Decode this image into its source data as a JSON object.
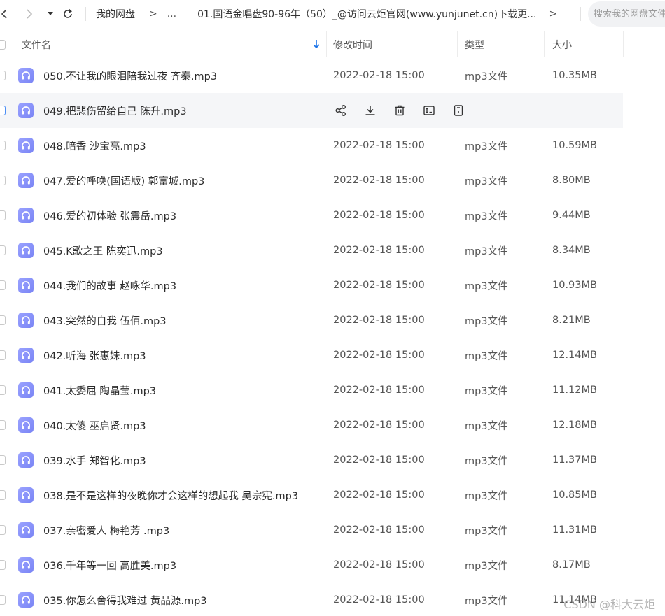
{
  "nav": {
    "back_icon": "chevron-left-icon",
    "forward_icon": "chevron-right-icon",
    "history_icon": "caret-down-icon",
    "refresh_icon": "refresh-icon"
  },
  "breadcrumb": {
    "root": "我的网盘",
    "sep": ">",
    "ellipsis": "...",
    "current": "01.国语金唱盘90-96年（50）_@访问云炬官网(www.yunjunet.cn)下载更...",
    "end_sep": ">"
  },
  "search": {
    "placeholder": "搜索我的网盘文件"
  },
  "table": {
    "headers": {
      "name": "文件名",
      "time": "修改时间",
      "type": "类型",
      "size": "大小"
    },
    "sort_icon": "arrow-down-icon",
    "rows": [
      {
        "name": "050.不让我的眼泪陪我过夜  齐秦.mp3",
        "time": "2022-02-18 15:00",
        "type": "mp3文件",
        "size": "10.35MB"
      },
      {
        "name": "049.把悲伤留给自己 陈升.mp3",
        "time": "",
        "type": "",
        "size": "",
        "hover": true
      },
      {
        "name": "048.暗香  沙宝亮.mp3",
        "time": "2022-02-18 15:00",
        "type": "mp3文件",
        "size": "10.59MB"
      },
      {
        "name": "047.爱的呼唤(国语版) 郭富城.mp3",
        "time": "2022-02-18 15:00",
        "type": "mp3文件",
        "size": "8.80MB"
      },
      {
        "name": "046.爱的初体验  张震岳.mp3",
        "time": "2022-02-18 15:00",
        "type": "mp3文件",
        "size": "9.44MB"
      },
      {
        "name": "045.K歌之王  陈奕迅.mp3",
        "time": "2022-02-18 15:00",
        "type": "mp3文件",
        "size": "8.34MB"
      },
      {
        "name": "044.我们的故事  赵咏华.mp3",
        "time": "2022-02-18 15:00",
        "type": "mp3文件",
        "size": "10.93MB"
      },
      {
        "name": "043.突然的自我   伍佰.mp3",
        "time": "2022-02-18 15:00",
        "type": "mp3文件",
        "size": "8.21MB"
      },
      {
        "name": "042.听海  张惠妹.mp3",
        "time": "2022-02-18 15:00",
        "type": "mp3文件",
        "size": "12.14MB"
      },
      {
        "name": "041.太委屈  陶晶莹.mp3",
        "time": "2022-02-18 15:00",
        "type": "mp3文件",
        "size": "11.12MB"
      },
      {
        "name": "040.太傻  巫启贤.mp3",
        "time": "2022-02-18 15:00",
        "type": "mp3文件",
        "size": "12.18MB"
      },
      {
        "name": "039.水手  郑智化.mp3",
        "time": "2022-02-18 15:00",
        "type": "mp3文件",
        "size": "11.37MB"
      },
      {
        "name": "038.是不是这样的夜晚你才会这样的想起我  吴宗宪.mp3",
        "time": "2022-02-18 15:00",
        "type": "mp3文件",
        "size": "10.85MB"
      },
      {
        "name": "037.亲密爱人 梅艳芳  .mp3",
        "time": "2022-02-18 15:00",
        "type": "mp3文件",
        "size": "11.31MB"
      },
      {
        "name": "036.千年等一回   高胜美.mp3",
        "time": "2022-02-18 15:00",
        "type": "mp3文件",
        "size": "8.17MB"
      },
      {
        "name": "035.你怎么舍得我难过  黄品源.mp3",
        "time": "2022-02-18 15:00",
        "type": "mp3文件",
        "size": "11.14MB"
      }
    ],
    "hover_actions": [
      "share-icon",
      "download-icon",
      "delete-icon",
      "rename-icon",
      "more-icon"
    ],
    "file_icon": "headphones-icon"
  },
  "watermark": "CSDN @科大云炬",
  "colors": {
    "accent": "#1a73e8",
    "file_icon": "#8a92fb",
    "hover_row": "#f5f6f8"
  }
}
